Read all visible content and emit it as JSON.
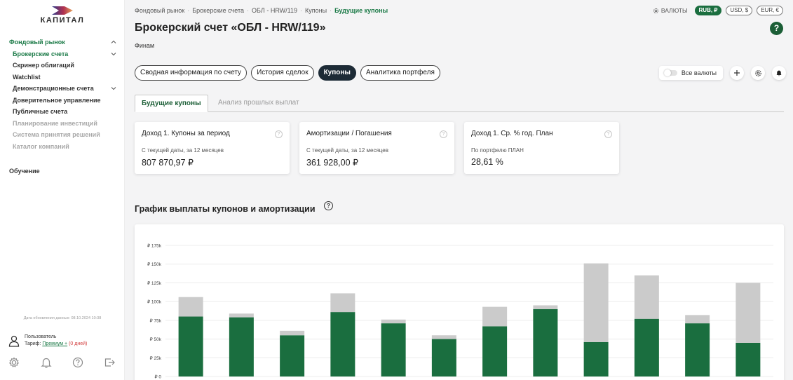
{
  "colors": {
    "accent": "#1b7a47",
    "accent_dark": "#1b5e36",
    "bar_coupon": "#1a6e3f",
    "bar_amortization": "#cbcbcb",
    "pill_active_bg": "#1d2b36"
  },
  "sidebar": {
    "logo_text": "КАПИТАЛ",
    "nav": [
      {
        "label": "Фондовый рынок",
        "state": "top",
        "chevron": "up"
      },
      {
        "label": "Брокерские счета",
        "state": "active",
        "chevron": "down"
      },
      {
        "label": "Скринер облигаций",
        "state": "normal"
      },
      {
        "label": "Watchlist",
        "state": "normal"
      },
      {
        "label": "Демонстрационные счета",
        "state": "normal",
        "chevron": "down"
      },
      {
        "label": "Доверительное управление",
        "state": "normal"
      },
      {
        "label": "Публичные счета",
        "state": "normal"
      },
      {
        "label": "Планирование инвестиций",
        "state": "muted"
      },
      {
        "label": "Система принятия решений",
        "state": "muted"
      },
      {
        "label": "Каталог компаний",
        "state": "muted"
      }
    ],
    "learning_label": "Обучение",
    "update_date": "Дата обновления данных: 08.10.2024 10:38",
    "user": {
      "name": "Пользователь",
      "tariff_prefix": "Тариф: ",
      "tariff_plan": "Премиум +",
      "tariff_days": " (0 дней)"
    },
    "bottom_icons": [
      "gear-icon",
      "bell-icon",
      "help-icon",
      "logout-icon"
    ]
  },
  "header": {
    "breadcrumb": [
      "Фондовый рынок",
      "Брокерские счета",
      "ОБЛ - HRW/119",
      "Купоны",
      "Будущие купоны"
    ],
    "currency_label": "ВАЛЮТЫ",
    "currencies": [
      {
        "label": "RUB, ₽",
        "active": true
      },
      {
        "label": "USD, $",
        "active": false
      },
      {
        "label": "EUR, €",
        "active": false
      }
    ],
    "title": "Брокерский счет «ОБЛ - HRW/119»",
    "help_label": "?",
    "broker": "Финам"
  },
  "tabs": [
    {
      "label": "Сводная информация по счету",
      "active": false
    },
    {
      "label": "История сделок",
      "active": false
    },
    {
      "label": "Купоны",
      "active": true
    },
    {
      "label": "Аналитика портфеля",
      "active": false
    }
  ],
  "toolbar": {
    "all_currencies_label": "Все валюты",
    "add_icon": "plus-icon",
    "settings_icon": "gear-icon",
    "notification_icon": "bell-icon"
  },
  "sub_tabs": [
    {
      "label": "Будущие купоны",
      "active": true
    },
    {
      "label": "Анализ прошлых выплат",
      "active": false
    }
  ],
  "cards": [
    {
      "title": "Доход 1. Купоны за период",
      "help": "?",
      "subtitle": "С текущей даты, за 12 месяцев",
      "value": "807 870,97 ₽"
    },
    {
      "title": "Амортизации / Погашения",
      "help": "?",
      "subtitle": "С текущей даты, за 12 месяцев",
      "value": "361 928,00 ₽"
    },
    {
      "title": "Доход 1. Ср. % год. План",
      "help": "?",
      "subtitle": "По портфелю ПЛАН",
      "value": "28,61 %"
    }
  ],
  "chart_section": {
    "title": "График выплаты купонов и амортизации",
    "help": "?"
  },
  "chart_data": {
    "type": "bar",
    "stacked": true,
    "ylim": [
      0,
      175000
    ],
    "y_ticks": [
      0,
      25000,
      50000,
      75000,
      100000,
      125000,
      150000,
      175000
    ],
    "y_tick_labels": [
      "₽ 0",
      "₽ 25k",
      "₽ 50k",
      "₽ 75k",
      "₽ 100k",
      "₽ 125k",
      "₽ 150k",
      "₽ 175k"
    ],
    "grid": true,
    "series": [
      {
        "values": [
          80000,
          79000,
          55000,
          86000,
          71000,
          50000,
          67000,
          90000,
          46000,
          77000,
          71000,
          45000
        ]
      },
      {
        "values": [
          26000,
          5000,
          6000,
          25000,
          5000,
          5000,
          26000,
          5000,
          105000,
          58000,
          11000,
          80000
        ]
      }
    ]
  }
}
